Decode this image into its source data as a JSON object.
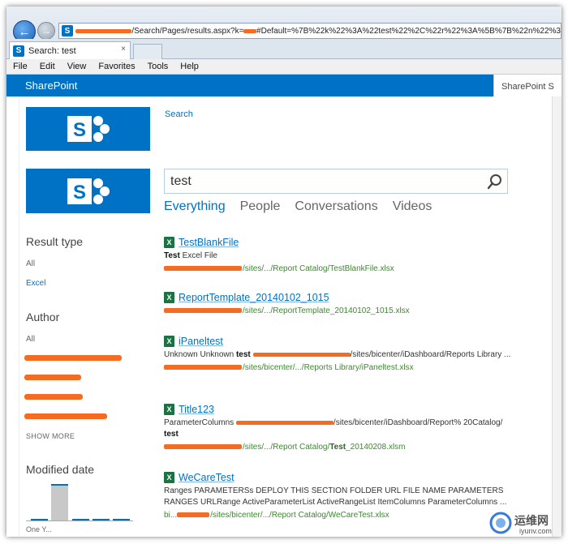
{
  "browser": {
    "url_prefix": "/Search/Pages/results.aspx?k=",
    "url_suffix": "#Default=%7B%22k%22%3A%22test%22%2C%22r%22%3A%5B%7B%22n%22%3",
    "tab_title": "Search: test",
    "tab_close": "×"
  },
  "menu": [
    "File",
    "Edit",
    "View",
    "Favorites",
    "Tools",
    "Help"
  ],
  "suite_bar": {
    "brand": "SharePoint",
    "right_text": "SharePoint S"
  },
  "page": {
    "search_link": "Search",
    "search_value": "test",
    "verticals": [
      "Everything",
      "People",
      "Conversations",
      "Videos"
    ]
  },
  "refiners": {
    "result_type_title": "Result type",
    "result_type_all": "All",
    "result_type_excel": "Excel",
    "author_title": "Author",
    "author_all": "All",
    "show_more": "SHOW MORE",
    "modified_title": "Modified date",
    "modified_caption": "One Y..."
  },
  "results": [
    {
      "title": "TestBlankFile",
      "summary_bold": "Test",
      "summary_rest": " Excel File",
      "path": "/sites/.../Report Catalog/TestBlankFile.xlsx"
    },
    {
      "title": "ReportTemplate_20140102_1015",
      "path": "/sites/.../ReportTemplate_20140102_1015.xlsx"
    },
    {
      "title": "iPaneltest",
      "summary_pre": "Unknown Unknown ",
      "summary_bold": "test",
      "summary_rest": "/sites/bicenter/iDashboard/Reports Library ...",
      "path": "/sites/bicenter/.../Reports Library/iPaneltest.xlsx"
    },
    {
      "title": "Title123",
      "summary_pre": "ParameterColumns ",
      "summary_rest": "/sites/bicenter/iDashboard/Report% 20Catalog/ ",
      "summary_bold": "test",
      "path_pre": "/sites/.../Report Catalog/",
      "path_bold": "Test",
      "path_post": "_20140208.xlsm"
    },
    {
      "title": "WeCareTest",
      "summary": "Ranges PARAMETERSs DEPLOY THIS SECTION FOLDER URL FILE NAME PARAMETERS RANGES URLRange ActiveParameterList ActiveRangeList ItemColumns ParameterColumns ...",
      "path_pre": "bi...",
      "path": "/sites/bicenter/.../Report Catalog/WeCareTest.xlsx"
    }
  ],
  "watermark": {
    "cn": "运维网",
    "site": "iyunv.com"
  },
  "colors": {
    "sp_blue": "#0072c6",
    "redaction": "#f36c21",
    "url_green": "#3a8a2c",
    "excel_green": "#1e7145"
  }
}
